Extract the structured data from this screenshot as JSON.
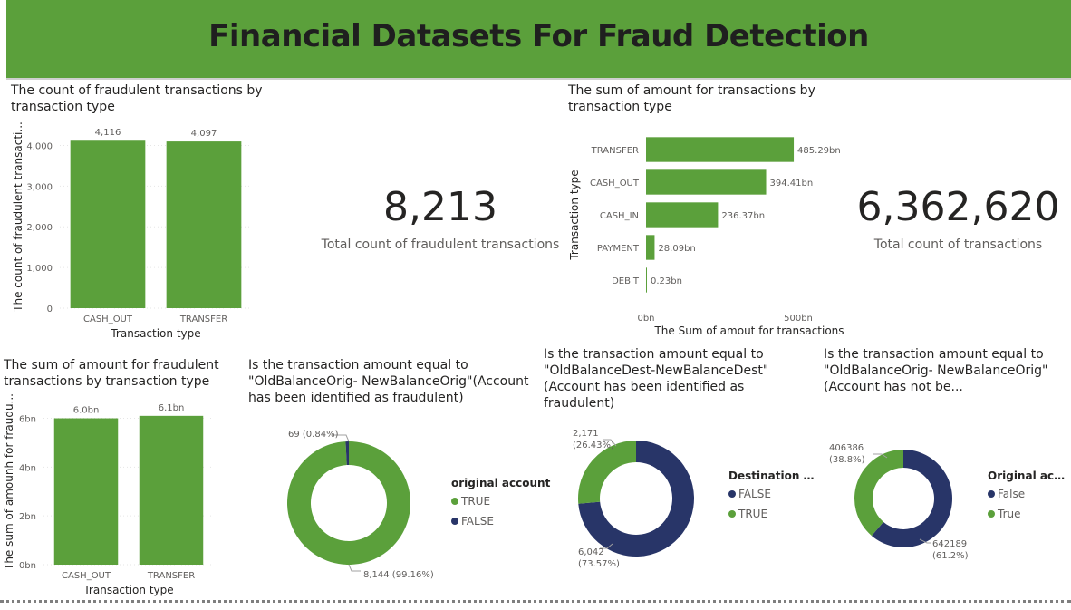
{
  "dashboard": {
    "title": "Financial Datasets For Fraud Detection",
    "colors": {
      "green": "#5ba03b",
      "navy": "#283568",
      "header": "#5ba03b"
    }
  },
  "cards": {
    "fraud_count": {
      "value": "8,213",
      "label": "Total count of fraudulent transactions"
    },
    "total_count": {
      "value": "6,362,620",
      "label": "Total count of transactions"
    }
  },
  "chart_data": [
    {
      "id": "fraud_count_by_type",
      "type": "bar",
      "title": "The count of fraudulent transactions by transaction type",
      "xlabel": "Transaction type",
      "ylabel": "The count of fraudulent transacti...",
      "categories": [
        "CASH_OUT",
        "TRANSFER"
      ],
      "values": [
        4116,
        4097
      ],
      "value_labels": [
        "4,116",
        "4,097"
      ],
      "yticks": [
        "0",
        "1,000",
        "2,000",
        "3,000",
        "4,000"
      ],
      "ylim": [
        0,
        4500
      ],
      "grid": true
    },
    {
      "id": "amount_by_type",
      "type": "bar",
      "orientation": "horizontal",
      "title": "The sum of amount for transactions by transaction type",
      "xlabel": "The Sum of amout for transactions",
      "ylabel": "Transaction type",
      "categories": [
        "TRANSFER",
        "CASH_OUT",
        "CASH_IN",
        "PAYMENT",
        "DEBIT"
      ],
      "values": [
        485.29,
        394.41,
        236.37,
        28.09,
        0.23
      ],
      "value_labels": [
        "485.29bn",
        "394.41bn",
        "236.37bn",
        "28.09bn",
        "0.23bn"
      ],
      "xticks": [
        "0bn",
        "500bn"
      ],
      "xlim": [
        0,
        500
      ],
      "unit": "bn"
    },
    {
      "id": "fraud_amount_by_type",
      "type": "bar",
      "title": "The sum of amount for fraudulent transactions by transaction type",
      "xlabel": "Transaction type",
      "ylabel": "The sum of amounh for fraudu...",
      "categories": [
        "CASH_OUT",
        "TRANSFER"
      ],
      "values": [
        6.0,
        6.1
      ],
      "value_labels": [
        "6.0bn",
        "6.1bn"
      ],
      "yticks": [
        "0bn",
        "2bn",
        "4bn",
        "6bn"
      ],
      "ylim": [
        0,
        6.8
      ],
      "unit": "bn",
      "grid": true
    },
    {
      "id": "orig_fraud_donut",
      "type": "pie",
      "title": "Is the transaction amount equal to \"OldBalanceOrig- NewBalanceOrig\"(Account has been identified as fraudulent)",
      "legend_title": "original account",
      "slices": [
        {
          "label": "TRUE",
          "value": 8144,
          "data_label": "8,144 (99.16%)",
          "color": "#5ba03b"
        },
        {
          "label": "FALSE",
          "value": 69,
          "data_label": "69 (0.84%)",
          "color": "#283568"
        }
      ]
    },
    {
      "id": "dest_fraud_donut",
      "type": "pie",
      "title": "Is the transaction amount equal to \"OldBalanceDest-NewBalanceDest\"(Account has been identified as fraudulent)",
      "legend_title": "Destination a...",
      "slices": [
        {
          "label": "FALSE",
          "value": 6042,
          "data_label_value": "6,042",
          "data_label_pct": "(73.57%)",
          "color": "#283568"
        },
        {
          "label": "TRUE",
          "value": 2171,
          "data_label_value": "2,171",
          "data_label_pct": "(26.43%)",
          "color": "#5ba03b"
        }
      ]
    },
    {
      "id": "orig_nonfraud_donut",
      "type": "pie",
      "title": "Is the transaction amount equal to \"OldBalanceOrig- NewBalanceOrig\"(Account has not be...",
      "legend_title": "Original acc...",
      "slices": [
        {
          "label": "False",
          "value": 642189,
          "data_label_value": "642189",
          "data_label_pct": "(61.2%)",
          "color": "#283568"
        },
        {
          "label": "True",
          "value": 406386,
          "data_label_value": "406386",
          "data_label_pct": "(38.8%)",
          "color": "#5ba03b"
        }
      ]
    }
  ]
}
